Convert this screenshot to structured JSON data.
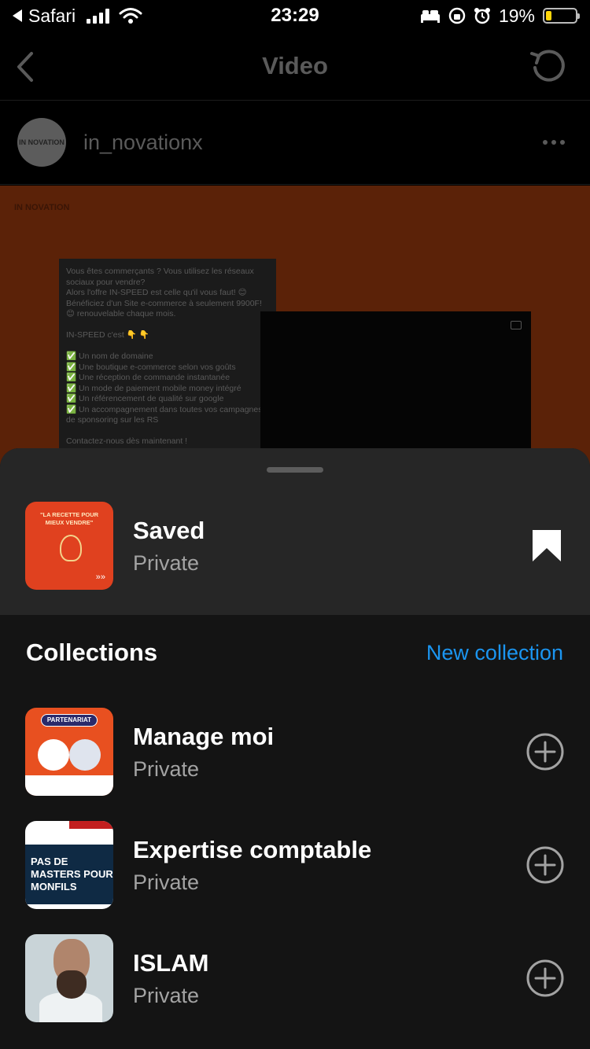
{
  "status_bar": {
    "back_app": "Safari",
    "time": "23:29",
    "battery": "19%",
    "battery_level": 0.19,
    "battery_color": "#ffd60a"
  },
  "background": {
    "nav_title": "Video",
    "username": "in_novationx",
    "avatar_text": "IN NOVATION",
    "brand_text": "IN NOVATION",
    "post_text": "Vous êtes commerçants ? Vous utilisez les réseaux sociaux pour vendre?\nAlors l'offre IN-SPEED est celle qu'il vous faut! 😊\nBénéficiez d'un Site e-commerce à seulement 9900F! 😊 renouvelable chaque mois.\n\nIN-SPEED c'est 👇 👇\n\n✅ Un nom de domaine\n✅ Une boutique e-commerce selon vos goûts\n✅ Une réception de commande instantanée\n✅ Un mode de paiement mobile money intégré\n✅ Un référencement de qualité sur google\n✅ Un accompagnement dans toutes vos campagnes de sponsoring sur les RS\n\nContactez-nous dès maintenant !"
  },
  "sheet": {
    "saved": {
      "title": "Saved",
      "subtitle": "Private",
      "thumb_text": "\"LA RECETTE POUR MIEUX VENDRE\"",
      "thumb_arrows": "»»"
    },
    "collections_title": "Collections",
    "new_collection_label": "New collection",
    "collections": [
      {
        "title": "Manage moi",
        "subtitle": "Private",
        "thumb_badge": "PARTENARIAT"
      },
      {
        "title": "Expertise comptable",
        "subtitle": "Private",
        "thumb_text": "PAS DE MASTERS POUR MONFILS"
      },
      {
        "title": "ISLAM",
        "subtitle": "Private"
      }
    ]
  },
  "colors": {
    "accent": "#1b95f0",
    "sheet_top": "#262626",
    "sheet_body": "#141414"
  }
}
